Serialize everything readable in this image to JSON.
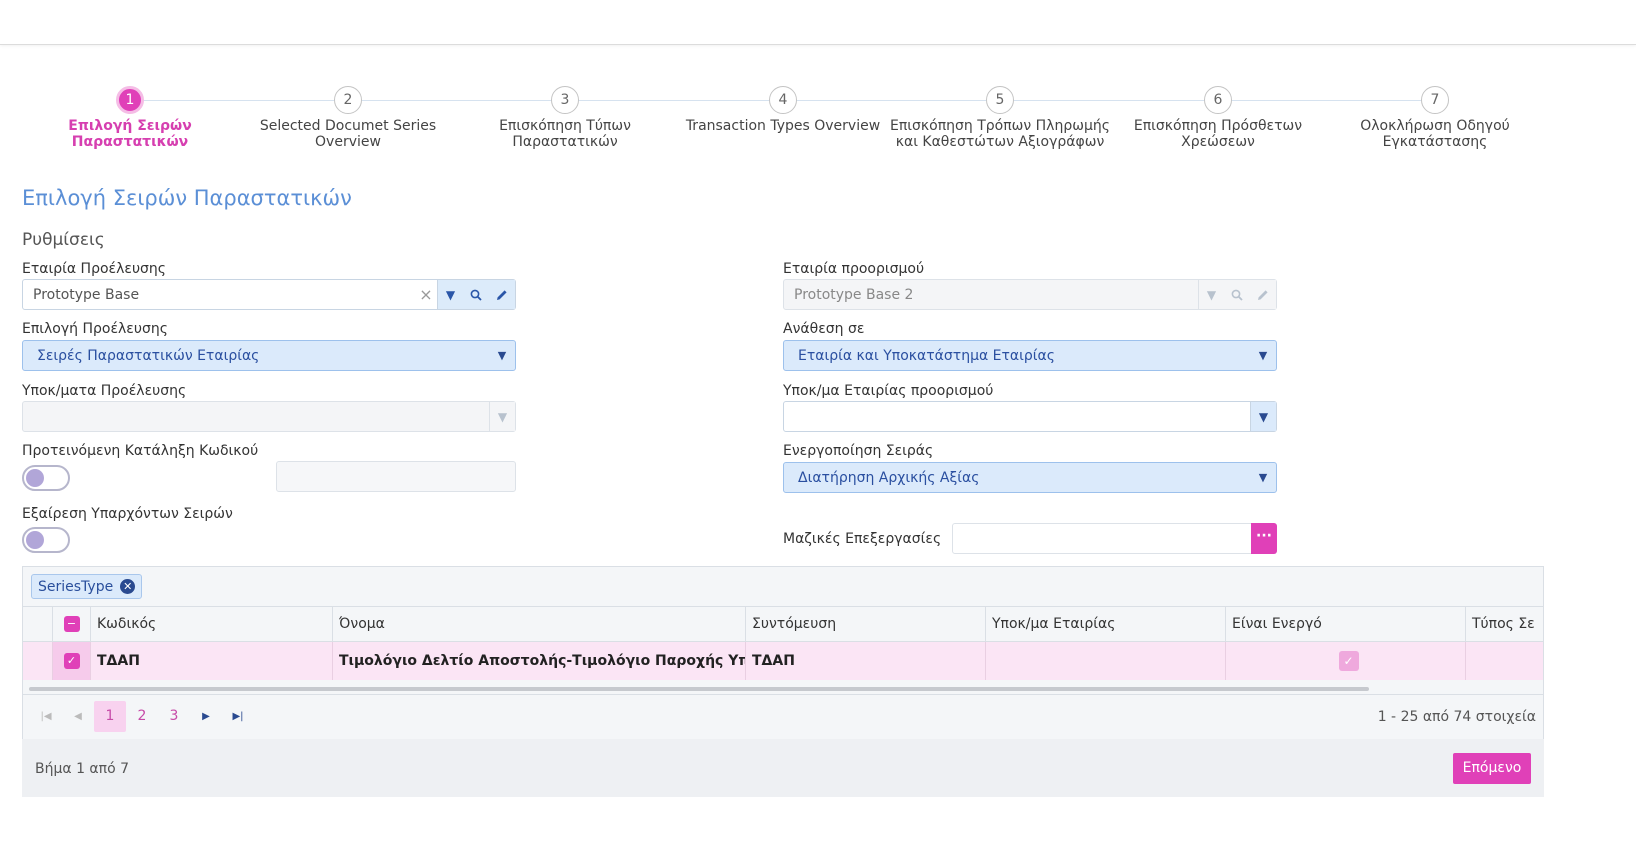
{
  "steps": [
    {
      "num": "1",
      "label": "Επιλογή Σειρών Παραστατικών"
    },
    {
      "num": "2",
      "label": "Selected Documet Series Overview"
    },
    {
      "num": "3",
      "label": "Επισκόπηση Τύπων Παραστατικών"
    },
    {
      "num": "4",
      "label": "Transaction Types Overview"
    },
    {
      "num": "5",
      "label": "Επισκόπηση Τρόπων Πληρωμής και Καθεστώτων Αξιογράφων"
    },
    {
      "num": "6",
      "label": "Επισκόπηση Πρόσθετων Χρεώσεων"
    },
    {
      "num": "7",
      "label": "Ολοκλήρωση Οδηγού Εγκατάστασης"
    }
  ],
  "page": {
    "title": "Επιλογή Σειρών Παραστατικών",
    "section": "Ρυθμίσεις"
  },
  "form": {
    "source_company": {
      "label": "Εταιρία Προέλευσης",
      "value": "Prototype Base"
    },
    "target_company": {
      "label": "Εταιρία προορισμού",
      "value": "Prototype Base 2"
    },
    "source_choice": {
      "label": "Επιλογή Προέλευσης",
      "value": "Σειρές Παραστατικών Εταιρίας"
    },
    "assign_to": {
      "label": "Ανάθεση σε",
      "value": "Εταιρία και Υποκατάστημα Εταιρίας"
    },
    "source_branches": {
      "label": "Υποκ/ματα Προέλευσης",
      "value": ""
    },
    "target_branch": {
      "label": "Υποκ/μα Εταιρίας προορισμού",
      "value": ""
    },
    "code_suffix": {
      "label": "Προτεινόμενη Κατάληξη Κωδικού"
    },
    "series_activation": {
      "label": "Ενεργοποίηση Σειράς",
      "value": "Διατήρηση Αρχικής Αξίας"
    },
    "exclude_existing": {
      "label": "Εξαίρεση Υπαρχόντων Σειρών"
    },
    "mass_processing": {
      "label": "Μαζικές Επεξεργασίες"
    }
  },
  "grid": {
    "group_chip": "SeriesType",
    "columns": [
      "Κωδικός",
      "Όνομα",
      "Συντόμευση",
      "Υποκ/μα Εταιρίας",
      "Είναι Ενεργό",
      "Τύπος Σε"
    ],
    "rows": [
      {
        "code": "ΤΔΑΠ",
        "name": "Τιμολόγιο Δελτίο Αποστολής-Τιμολόγιο Παροχής Υπηρεσιών",
        "short": "ΤΔΑΠ",
        "branch": "",
        "active": true,
        "type": "",
        "selected": true
      }
    ],
    "pager": {
      "pages": [
        "1",
        "2",
        "3"
      ],
      "current": "1",
      "info": "1 - 25 από 74 στοιχεία"
    }
  },
  "footer": {
    "step_info": "Βήμα 1 από 7",
    "next_label": "Επόμενο"
  },
  "colors": {
    "accent": "#e040b8",
    "title_blue": "#5b8fd6",
    "selected_row": "#fbe5f5"
  }
}
